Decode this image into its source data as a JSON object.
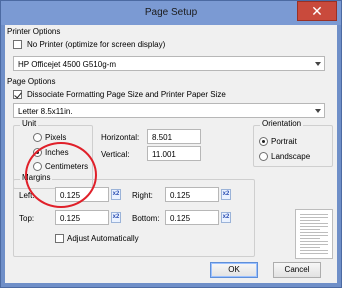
{
  "window": {
    "title": "Page Setup",
    "close_glyph": "✕"
  },
  "printer_options": {
    "label": "Printer Options",
    "no_printer_label": "No Printer (optimize for screen display)",
    "printer_value": "HP Officejet 4500 G510g-m"
  },
  "page_options": {
    "label": "Page Options",
    "dissociate_label": "Dissociate Formatting Page Size and Printer Paper Size",
    "paper_value": "Letter 8.5x11in."
  },
  "unit": {
    "label": "Unit",
    "options": [
      "Pixels",
      "Inches",
      "Centimeters"
    ],
    "selected": "Inches"
  },
  "size": {
    "horizontal_label": "Horizontal:",
    "horizontal_value": "8.501",
    "vertical_label": "Vertical:",
    "vertical_value": "11.001"
  },
  "orientation": {
    "label": "Orientation",
    "options": [
      "Portrait",
      "Landscape"
    ],
    "selected": "Portrait"
  },
  "margins": {
    "label": "Margins",
    "left_label": "Left:",
    "left_value": "0.125",
    "right_label": "Right:",
    "right_value": "0.125",
    "top_label": "Top:",
    "top_value": "0.125",
    "bottom_label": "Bottom:",
    "bottom_value": "0.125",
    "adjust_label": "Adjust Automatically",
    "unit_button_glyph": "x2"
  },
  "buttons": {
    "ok": "OK",
    "cancel": "Cancel"
  },
  "colors": {
    "highlight_ring": "#e0202a",
    "title_bar": "#7b9ad3",
    "close_button": "#c94a3c"
  }
}
